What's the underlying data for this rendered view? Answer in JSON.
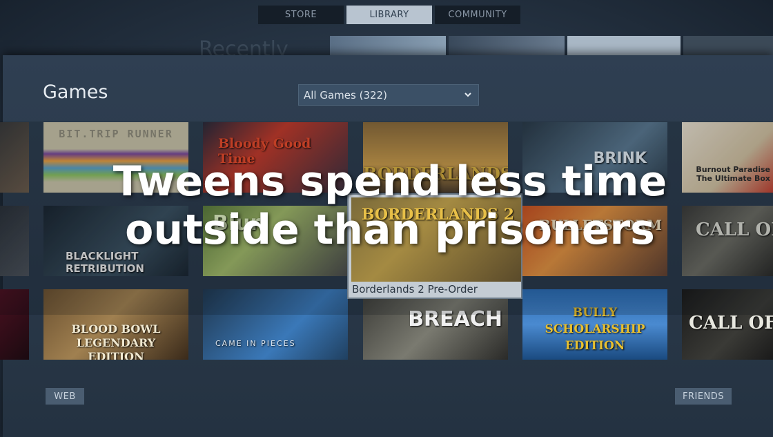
{
  "nav": {
    "tabs": [
      {
        "label": "STORE",
        "active": false
      },
      {
        "label": "LIBRARY",
        "active": true
      },
      {
        "label": "COMMUNITY",
        "active": false
      }
    ]
  },
  "recent": {
    "title": "Recently"
  },
  "library": {
    "title": "Games",
    "filter": {
      "value": "All Games (322)",
      "icon": "chevron-down-icon"
    }
  },
  "tiles": [
    {
      "title": "BIT.TRIP RUNNER"
    },
    {
      "title": "Bloody Good Time"
    },
    {
      "title": "BORDERLANDS"
    },
    {
      "title": "BRINK"
    },
    {
      "title": "Burnout Paradise The Ultimate Box"
    },
    {
      "title": "BLACKLIGHT RETRIBUTION"
    },
    {
      "title": "Blur"
    },
    {
      "title": "BULLETSTORM"
    },
    {
      "title": "CALL OF DUTY"
    },
    {
      "title": "BLOOD BOWL LEGENDARY EDITION"
    },
    {
      "title": "CAME IN PIECES"
    },
    {
      "title": "BREACH"
    },
    {
      "title": "BULLY SCHOLARSHIP EDITION"
    },
    {
      "title": "CALL OF DUTY"
    }
  ],
  "hover": {
    "label": "Borderlands 2 Pre-Order",
    "art_title": "BORDERLANDS 2"
  },
  "headline": {
    "line1": "Tweens spend less time",
    "line2": "outside than prisoners"
  },
  "footer": {
    "web": "WEB",
    "friends": "FRIENDS"
  },
  "colors": {
    "accent": "#b8c4d0",
    "panel": "#2f3f52",
    "headline": "#ffffff"
  }
}
